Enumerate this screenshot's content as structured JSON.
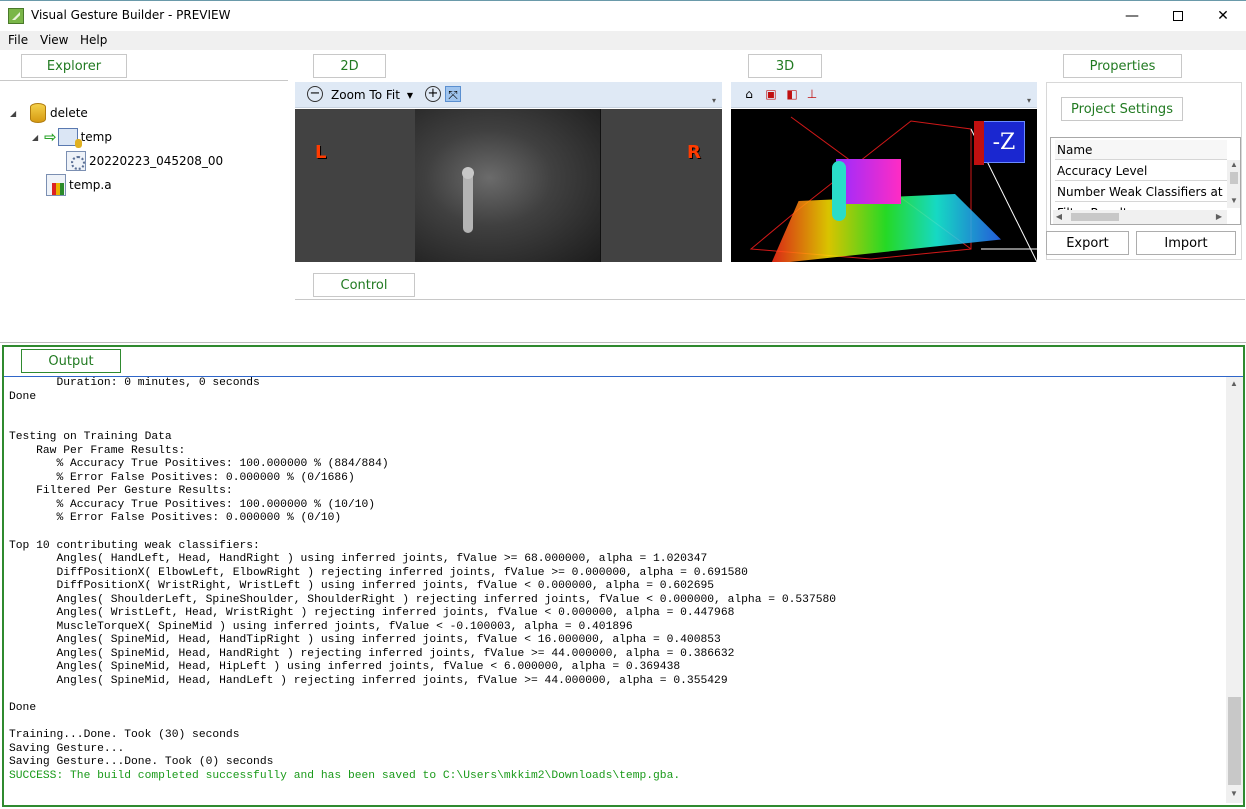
{
  "window": {
    "title": "Visual Gesture Builder - PREVIEW",
    "minimize": "—",
    "maximize": "",
    "close": "✕"
  },
  "menu": [
    {
      "label": "File"
    },
    {
      "label": "View"
    },
    {
      "label": "Help"
    }
  ],
  "panes": {
    "explorer": "Explorer",
    "view2d": "2D",
    "view3d": "3D",
    "properties": "Properties",
    "control": "Control",
    "output": "Output"
  },
  "tree": [
    {
      "label": "delete"
    },
    {
      "label": "temp"
    },
    {
      "label": "20220223_045208_00"
    },
    {
      "label": "temp.a"
    }
  ],
  "toolbar2d": {
    "zoom_label": "Zoom To Fit"
  },
  "view2d": {
    "left_marker": "L",
    "right_marker": "R"
  },
  "view3d": {
    "cube_label": "-Z"
  },
  "properties": {
    "project_settings": "Project Settings",
    "grid": {
      "header": "Name",
      "rows": [
        "Accuracy Level",
        "Number Weak Classifiers at Ru",
        "Filter Results"
      ]
    },
    "export_label": "Export",
    "import_label": "Import"
  },
  "output": {
    "lines": [
      "       Duration: 0 minutes, 0 seconds",
      "Done",
      "",
      "",
      "Testing on Training Data",
      "    Raw Per Frame Results:",
      "       % Accuracy True Positives: 100.000000 % (884/884)",
      "       % Error False Positives: 0.000000 % (0/1686)",
      "    Filtered Per Gesture Results:",
      "       % Accuracy True Positives: 100.000000 % (10/10)",
      "       % Error False Positives: 0.000000 % (0/10)",
      "",
      "Top 10 contributing weak classifiers:",
      "       Angles( HandLeft, Head, HandRight ) using inferred joints, fValue >= 68.000000, alpha = 1.020347",
      "       DiffPositionX( ElbowLeft, ElbowRight ) rejecting inferred joints, fValue >= 0.000000, alpha = 0.691580",
      "       DiffPositionX( WristRight, WristLeft ) using inferred joints, fValue < 0.000000, alpha = 0.602695",
      "       Angles( ShoulderLeft, SpineShoulder, ShoulderRight ) rejecting inferred joints, fValue < 0.000000, alpha = 0.537580",
      "       Angles( WristLeft, Head, WristRight ) rejecting inferred joints, fValue < 0.000000, alpha = 0.447968",
      "       MuscleTorqueX( SpineMid ) using inferred joints, fValue < -0.100003, alpha = 0.401896",
      "       Angles( SpineMid, Head, HandTipRight ) using inferred joints, fValue < 16.000000, alpha = 0.400853",
      "       Angles( SpineMid, Head, HandRight ) rejecting inferred joints, fValue >= 44.000000, alpha = 0.386632",
      "       Angles( SpineMid, Head, HipLeft ) using inferred joints, fValue < 6.000000, alpha = 0.369438",
      "       Angles( SpineMid, Head, HandLeft ) rejecting inferred joints, fValue >= 44.000000, alpha = 0.355429",
      "",
      "Done",
      "",
      "Training...Done. Took (30) seconds",
      "Saving Gesture...",
      "Saving Gesture...Done. Took (0) seconds"
    ],
    "success": "SUCCESS: The build completed successfully and has been saved to C:\\Users\\mkkim2\\Downloads\\temp.gba."
  }
}
